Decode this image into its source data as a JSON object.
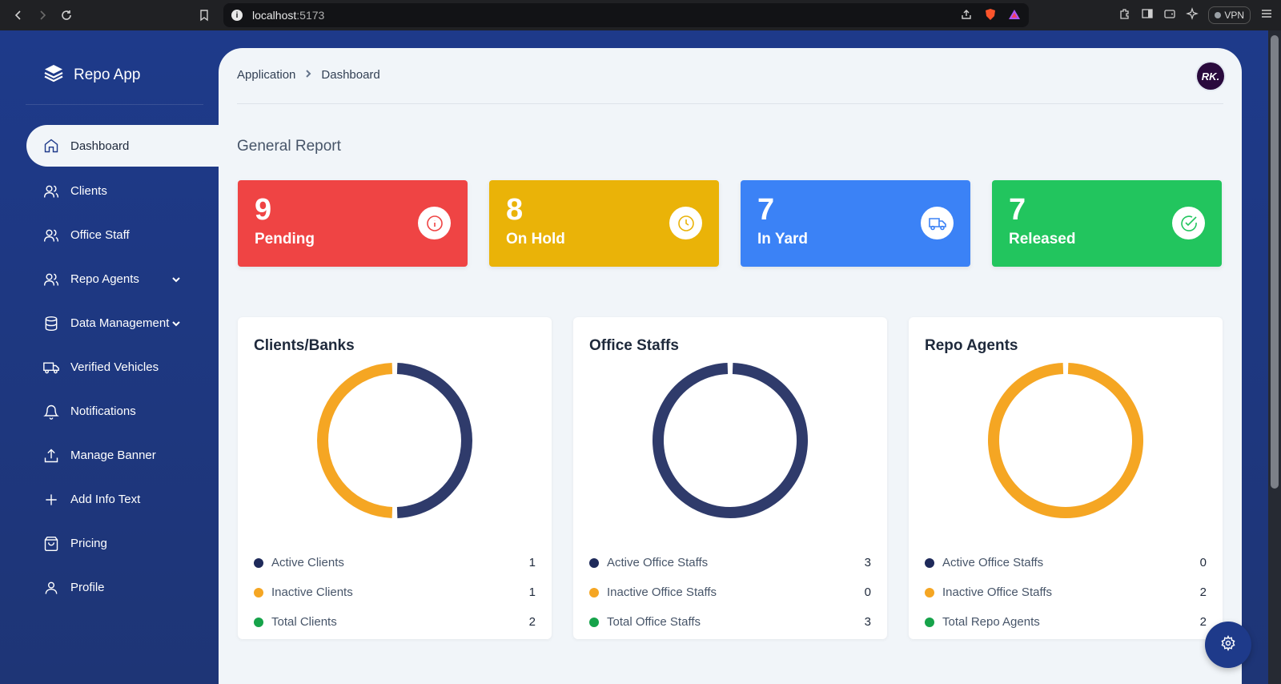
{
  "browser": {
    "url_host": "localhost",
    "url_port": ":5173",
    "vpn_label": "VPN"
  },
  "app": {
    "brand": "Repo App"
  },
  "sidebar": {
    "items": [
      {
        "label": "Dashboard",
        "icon": "home-icon",
        "active": true
      },
      {
        "label": "Clients",
        "icon": "users-icon"
      },
      {
        "label": "Office Staff",
        "icon": "users-icon"
      },
      {
        "label": "Repo Agents",
        "icon": "users-icon",
        "expandable": true
      },
      {
        "label": "Data Management",
        "icon": "database-icon",
        "expandable": true
      },
      {
        "label": "Verified Vehicles",
        "icon": "truck-icon"
      },
      {
        "label": "Notifications",
        "icon": "bell-icon"
      },
      {
        "label": "Manage Banner",
        "icon": "upload-icon"
      },
      {
        "label": "Add Info Text",
        "icon": "plus-icon"
      },
      {
        "label": "Pricing",
        "icon": "shopping-bag-icon"
      },
      {
        "label": "Profile",
        "icon": "user-icon"
      }
    ]
  },
  "header": {
    "breadcrumb": [
      "Application",
      "Dashboard"
    ],
    "avatar_initials": "RK."
  },
  "report": {
    "title": "General Report",
    "stats": [
      {
        "value": "9",
        "label": "Pending",
        "color": "#ef4444",
        "icon": "info-icon"
      },
      {
        "value": "8",
        "label": "On Hold",
        "color": "#eab308",
        "icon": "clock-icon"
      },
      {
        "value": "7",
        "label": "In Yard",
        "color": "#3b82f6",
        "icon": "truck-icon"
      },
      {
        "value": "7",
        "label": "Released",
        "color": "#22c55e",
        "icon": "check-circle-icon"
      }
    ]
  },
  "colors": {
    "active": "#2f3b6b",
    "inactive": "#f5a623",
    "total": "#16a34a"
  },
  "chart_data": [
    {
      "type": "pie",
      "title": "Clients/Banks",
      "segments": [
        {
          "name": "Active Clients",
          "value": 1
        },
        {
          "name": "Inactive Clients",
          "value": 1
        }
      ],
      "legend": [
        {
          "name": "Active Clients",
          "value": "1"
        },
        {
          "name": "Inactive Clients",
          "value": "1"
        },
        {
          "name": "Total Clients",
          "value": "2"
        }
      ]
    },
    {
      "type": "pie",
      "title": "Office Staffs",
      "segments": [
        {
          "name": "Active Office Staffs",
          "value": 3
        },
        {
          "name": "Inactive Office Staffs",
          "value": 0
        }
      ],
      "legend": [
        {
          "name": "Active Office Staffs",
          "value": "3"
        },
        {
          "name": "Inactive Office Staffs",
          "value": "0"
        },
        {
          "name": "Total Office Staffs",
          "value": "3"
        }
      ]
    },
    {
      "type": "pie",
      "title": "Repo Agents",
      "segments": [
        {
          "name": "Active Office Staffs",
          "value": 0
        },
        {
          "name": "Inactive Office Staffs",
          "value": 2
        }
      ],
      "legend": [
        {
          "name": "Active Office Staffs",
          "value": "0"
        },
        {
          "name": "Inactive Office Staffs",
          "value": "2"
        },
        {
          "name": "Total Repo Agents",
          "value": "2"
        }
      ]
    }
  ]
}
